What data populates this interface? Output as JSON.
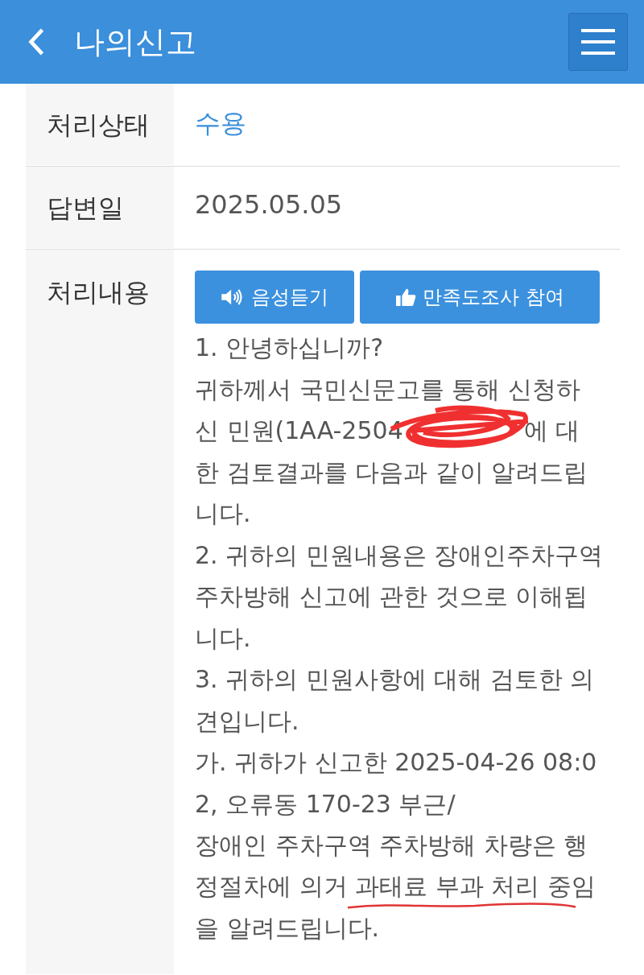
{
  "header": {
    "title": "나의신고"
  },
  "rows": [
    {
      "label": "처리상태",
      "value": "수용",
      "kind": "status"
    },
    {
      "label": "답변일",
      "value": "2025.05.05",
      "kind": "text"
    },
    {
      "label": "처리내용",
      "kind": "content",
      "buttons": [
        {
          "label": "음성듣기"
        },
        {
          "label": "만족도조사 참여"
        }
      ],
      "lines": [
        {
          "kind": "plain",
          "text": "1. 안녕하십니까?"
        },
        {
          "kind": "plain",
          "text": "귀하께서 국민신문고를 통해 신청하"
        },
        {
          "kind": "scribbled",
          "before": "신 민원(1AA-2504",
          "after": "에 대"
        },
        {
          "kind": "plain",
          "text": "한 검토결과를 다음과 같이 알려드립"
        },
        {
          "kind": "plain",
          "text": "니다."
        },
        {
          "kind": "plain",
          "text": "2. 귀하의 민원내용은 장애인주차구역"
        },
        {
          "kind": "plain",
          "text": "주차방해 신고에 관한 것으로 이해됩"
        },
        {
          "kind": "plain",
          "text": "니다."
        },
        {
          "kind": "plain",
          "text": "3. 귀하의 민원사항에 대해 검토한 의"
        },
        {
          "kind": "plain",
          "text": "견입니다."
        },
        {
          "kind": "plain",
          "text": "가. 귀하가 신고한 2025-04-26 08:0"
        },
        {
          "kind": "plain",
          "text": "2, 오류동 170-23 부근/"
        },
        {
          "kind": "plain",
          "text": "장애인 주차구역 주차방해 차량은 행"
        },
        {
          "kind": "underlined",
          "before": "정절차에 의거 ",
          "marked": "과태료 부과 처리 중임"
        },
        {
          "kind": "plain",
          "text": "을 알려드립니다."
        }
      ]
    }
  ]
}
